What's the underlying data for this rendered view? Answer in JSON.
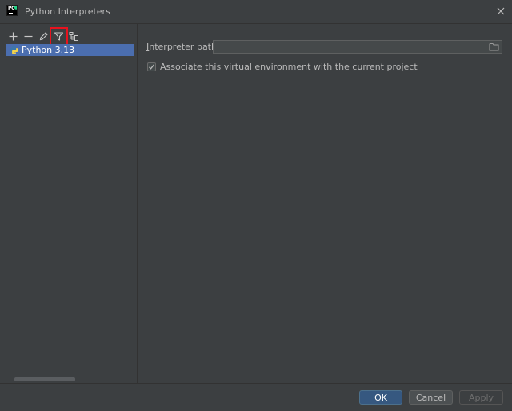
{
  "window": {
    "title": "Python Interpreters",
    "app_icon": "pycharm-logo",
    "logo_text": "PC"
  },
  "toolbar": {
    "buttons": [
      {
        "name": "add-icon",
        "icon": "plus"
      },
      {
        "name": "remove-icon",
        "icon": "minus"
      },
      {
        "name": "edit-icon",
        "icon": "pencil"
      },
      {
        "name": "filter-icon",
        "icon": "funnel",
        "highlighted": true
      },
      {
        "name": "show-paths-icon",
        "icon": "tree"
      }
    ]
  },
  "interpreters": [
    {
      "label": "Python 3.13",
      "selected": true,
      "icon": "python-icon"
    }
  ],
  "details": {
    "interpreter_path_label": "Interpreter path:",
    "interpreter_path_mnemonic": "I",
    "interpreter_path_rest": "nterpreter path:",
    "interpreter_path_value": "",
    "associate_label": "Associate this virtual environment with the current project",
    "associate_checked": true
  },
  "buttons": {
    "ok": "OK",
    "cancel": "Cancel",
    "apply": "Apply"
  },
  "colors": {
    "background": "#3c3f41",
    "selection": "#4b6eaf",
    "primary_button": "#365880",
    "highlight_outline": "#e8121e"
  }
}
